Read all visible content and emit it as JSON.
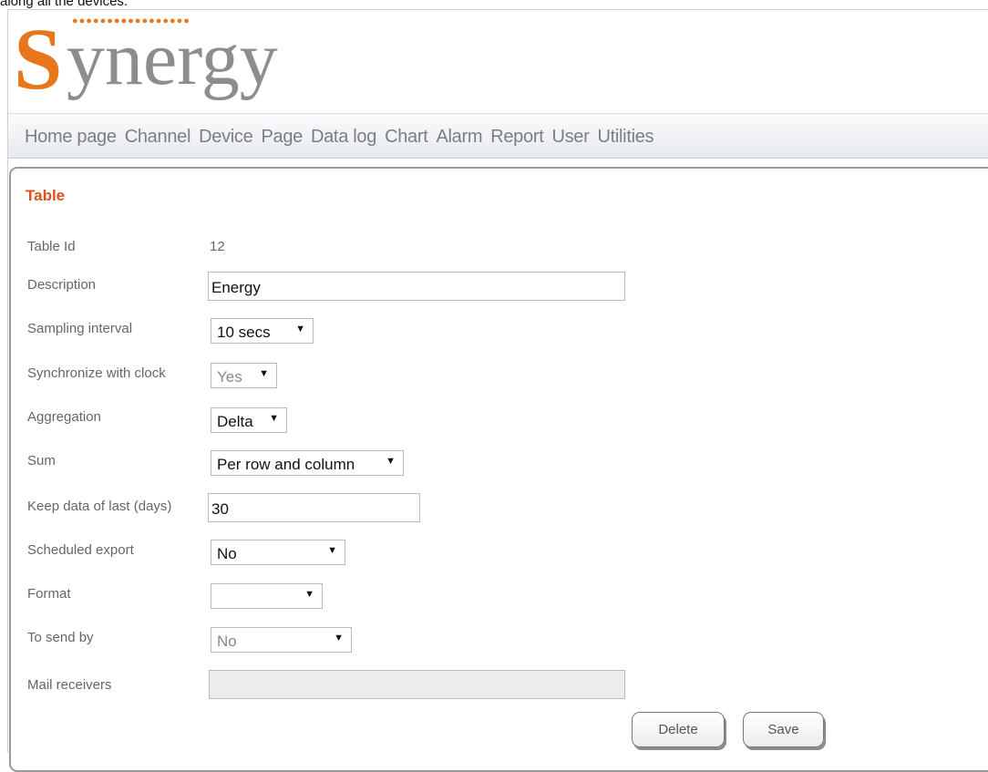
{
  "caption": "along all the devices.",
  "logo": {
    "s": "S",
    "rest": "ynergy",
    "dots": "●●●●●●●●●●●●●●●●●"
  },
  "nav": [
    "Home page",
    "Channel",
    "Device",
    "Page",
    "Data log",
    "Chart",
    "Alarm",
    "Report",
    "User",
    "Utilities"
  ],
  "form": {
    "title": "Table",
    "table_id": {
      "label": "Table Id",
      "value": "12"
    },
    "description": {
      "label": "Description",
      "value": "Energy"
    },
    "sampling_interval": {
      "label": "Sampling interval",
      "value": "10 secs"
    },
    "synchronize": {
      "label": "Synchronize with clock",
      "value": "Yes"
    },
    "aggregation": {
      "label": "Aggregation",
      "value": "Delta"
    },
    "sum": {
      "label": "Sum",
      "value": "Per row and column"
    },
    "keep_data": {
      "label": "Keep data of last (days)",
      "value": "30"
    },
    "scheduled_export": {
      "label": "Scheduled export",
      "value": "No"
    },
    "format": {
      "label": "Format",
      "value": ""
    },
    "send_by": {
      "label": "To send by",
      "value": "No"
    },
    "mail_receivers": {
      "label": "Mail receivers",
      "value": ""
    }
  },
  "buttons": {
    "delete": "Delete",
    "save": "Save"
  },
  "icons": {
    "dropdown": "▼"
  },
  "colors": {
    "accent": "#d9531e",
    "logo_orange": "#e8761c",
    "logo_gray": "#8d8d8d"
  }
}
